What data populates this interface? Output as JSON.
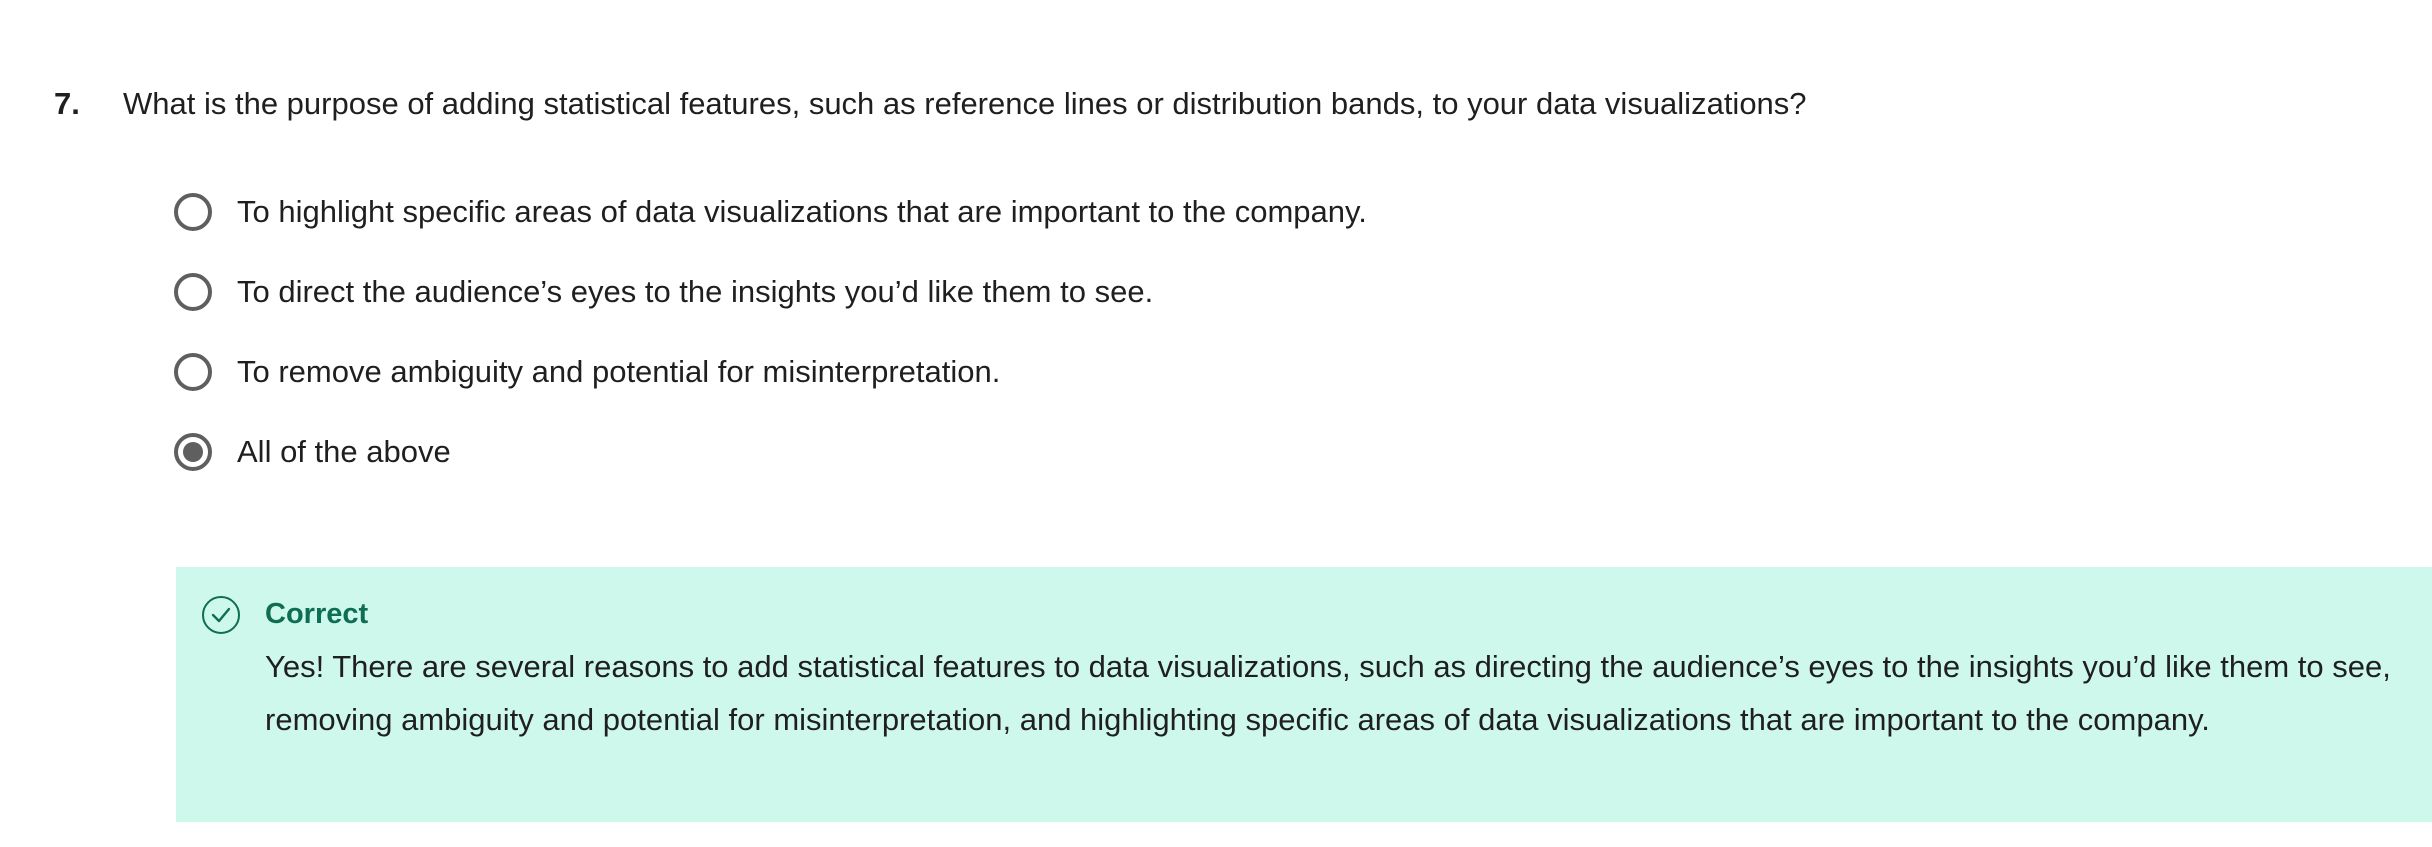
{
  "question": {
    "number": "7.",
    "text": "What is the purpose of adding statistical features, such as reference lines or distribution bands, to your data visualizations?",
    "options": [
      {
        "label": "To highlight specific areas of data visualizations that are important to the company.",
        "selected": false
      },
      {
        "label": "To direct the audience’s eyes to the insights you’d like them to see.",
        "selected": false
      },
      {
        "label": "To remove ambiguity and potential for misinterpretation.",
        "selected": false
      },
      {
        "label": "All of the above",
        "selected": true
      }
    ]
  },
  "feedback": {
    "icon": "check-circle-icon",
    "title": "Correct",
    "text": "Yes! There are several reasons to add statistical features to data visualizations, such as directing the audience’s eyes to the insights you’d like them to see, removing ambiguity and potential for misinterpretation, and highlighting specific areas of data visualizations that are important to the company.",
    "background_color": "#cff8ec",
    "accent_color": "#0d6e51"
  }
}
